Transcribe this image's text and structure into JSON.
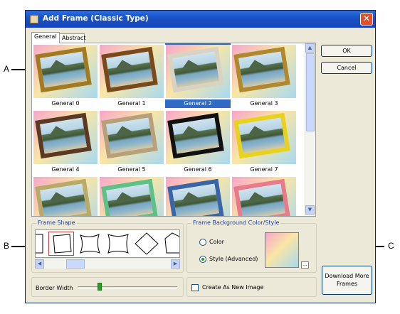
{
  "window": {
    "title": "Add Frame (Classic Type)",
    "close_glyph": "✕"
  },
  "tabs": [
    {
      "label": "General",
      "active": true
    },
    {
      "label": "Abstract",
      "active": false
    }
  ],
  "gallery": {
    "selected_index": 2,
    "items": [
      {
        "label": "General 0",
        "frame_color": "#a27a22"
      },
      {
        "label": "General 1",
        "frame_color": "#7a4a1c"
      },
      {
        "label": "General 2",
        "frame_color": "#d9d3c4"
      },
      {
        "label": "General 3",
        "frame_color": "#b08830"
      },
      {
        "label": "General 4",
        "frame_color": "#5a3a24"
      },
      {
        "label": "General 5",
        "frame_color": "#b8a07a"
      },
      {
        "label": "General 6",
        "frame_color": "#111111"
      },
      {
        "label": "General 7",
        "frame_color": "#e9d21c"
      },
      {
        "label": "",
        "frame_color": "#b9aa6a"
      },
      {
        "label": "",
        "frame_color": "#5fc08a"
      },
      {
        "label": "",
        "frame_color": "#3a66a8"
      },
      {
        "label": "",
        "frame_color": "#e97a8a"
      }
    ]
  },
  "buttons": {
    "ok": "OK",
    "cancel": "Cancel",
    "download": "Download More Frames"
  },
  "frame_shape": {
    "legend": "Frame Shape",
    "selected_index": 1
  },
  "border_width": {
    "label": "Border Width"
  },
  "background": {
    "legend": "Frame Background Color/Style",
    "options": [
      {
        "label": "Color",
        "selected": false
      },
      {
        "label": "Style (Advanced)",
        "selected": true
      }
    ],
    "more_glyph": "..."
  },
  "create_as_new_image": {
    "label": "Create As New Image",
    "checked": false
  },
  "callouts": {
    "a": "A",
    "b": "B",
    "c": "C"
  },
  "colors": {
    "title_blue": "#1a52c8",
    "selection_blue": "#316ac5",
    "dialog_bg": "#ece9d8"
  }
}
